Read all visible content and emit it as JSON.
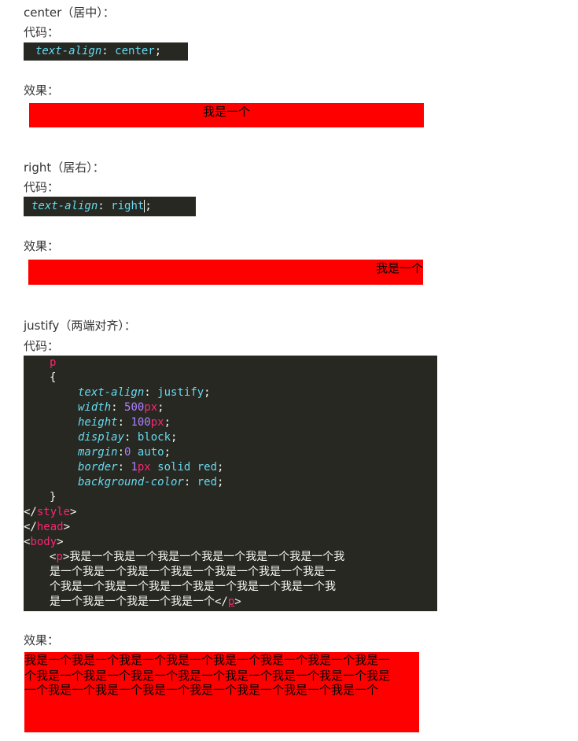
{
  "center_section": {
    "heading": "center（居中）：",
    "code_label": "代码：",
    "code": {
      "prop": "text-align",
      "value": "center"
    },
    "effect_label": "效果：",
    "demo_text": "我是一个"
  },
  "right_section": {
    "heading": "right（居右）：",
    "code_label": "代码：",
    "code": {
      "prop": "text-align",
      "value": "right"
    },
    "effect_label": "效果：",
    "demo_text": "我是一个"
  },
  "justify_section": {
    "heading": "justify（两端对齐）：",
    "code_label": "代码：",
    "code": {
      "selector": "p",
      "open_brace": "{",
      "decls": [
        {
          "prop": "text-align",
          "value": "justify"
        },
        {
          "prop": "width",
          "num": "500",
          "unit": "px"
        },
        {
          "prop": "height",
          "num": "100",
          "unit": "px"
        },
        {
          "prop": "display",
          "value": "block"
        },
        {
          "prop": "margin",
          "num": "0",
          "value": "auto"
        },
        {
          "prop": "border",
          "num": "1",
          "unit": "px",
          "value": "solid red"
        },
        {
          "prop": "background-color",
          "value": "red"
        }
      ],
      "close_brace": "}",
      "style_close": "style",
      "head_close": "head",
      "body_open": "body",
      "p_tag": "p",
      "p_lines": [
        "我是一个我是一个我是一个我是一个我是一个我是一个我",
        "是一个我是一个我是一个我是一个我是一个我是一个我是一",
        "个我是一个我是一个我是一个我是一个我是一个我是一个我",
        "是一个我是一个我是一个我是一个"
      ]
    },
    "effect_label": "效果：",
    "demo_lines": [
      "我是一个我是一个我是一个我是一个我是一个我是一个我是一个我是一",
      "个我是一个我是一个我是一个我是一个我是一个我是一个我是一个我是",
      "一个我是一个我是一个我是一个我是一个我是一个我是一个我是一个"
    ]
  },
  "colors": {
    "code_bg": "#272822",
    "demo_bg": "#ff0000"
  }
}
